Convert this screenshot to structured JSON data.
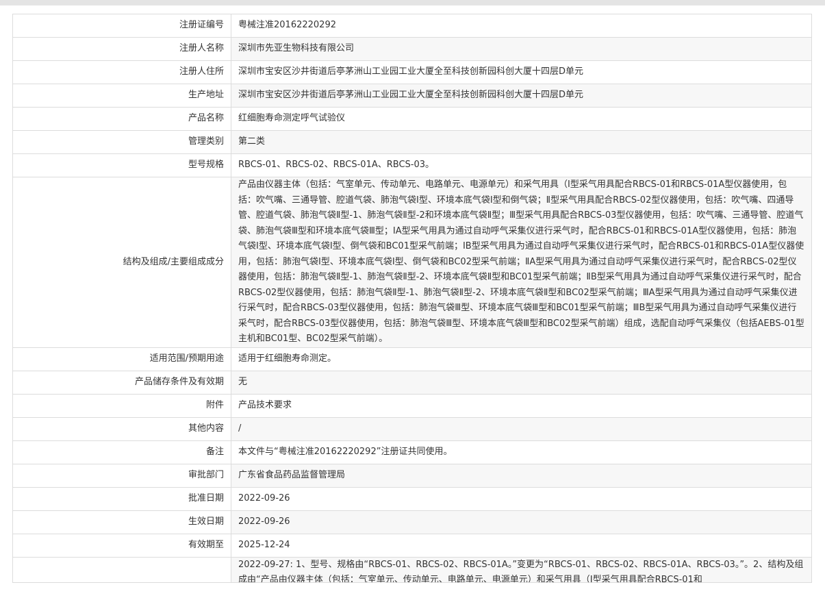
{
  "rows": [
    {
      "label": "注册证编号",
      "value": "粤械注准20162220292"
    },
    {
      "label": "注册人名称",
      "value": "深圳市先亚生物科技有限公司"
    },
    {
      "label": "注册人住所",
      "value": "深圳市宝安区沙井街道后亭茅洲山工业园工业大厦全至科技创新园科创大厦十四层D单元"
    },
    {
      "label": "生产地址",
      "value": "深圳市宝安区沙井街道后亭茅洲山工业园工业大厦全至科技创新园科创大厦十四层D单元"
    },
    {
      "label": "产品名称",
      "value": "红细胞寿命测定呼气试验仪"
    },
    {
      "label": "管理类别",
      "value": "第二类"
    },
    {
      "label": "型号规格",
      "value": "RBCS-01、RBCS-02、RBCS-01A、RBCS-03。"
    },
    {
      "label": "结构及组成/主要组成成分",
      "value": "产品由仪器主体（包括：气室单元、传动单元、电路单元、电源单元）和采气用具（Ⅰ型采气用具配合RBCS-01和RBCS-01A型仪器使用，包括：吹气嘴、三通导管、腔道气袋、肺泡气袋Ⅰ型、环境本底气袋Ⅰ型和倒气袋；Ⅱ型采气用具配合RBCS-02型仪器使用，包括：吹气嘴、四通导管、腔道气袋、肺泡气袋Ⅱ型-1、肺泡气袋Ⅱ型-2和环境本底气袋Ⅱ型；Ⅲ型采气用具配合RBCS-03型仪器使用，包括：吹气嘴、三通导管、腔道气袋、肺泡气袋Ⅲ型和环境本底气袋Ⅲ型；ⅠA型采气用具为通过自动呼气采集仪进行采气时，配合RBCS-01和RBCS-01A型仪器使用，包括：肺泡气袋Ⅰ型、环境本底气袋Ⅰ型、倒气袋和BC01型采气前端；ⅠB型采气用具为通过自动呼气采集仪进行采气时，配合RBCS-01和RBCS-01A型仪器使用，包括：肺泡气袋Ⅰ型、环境本底气袋Ⅰ型、倒气袋和BC02型采气前端；ⅡA型采气用具为通过自动呼气采集仪进行采气时，配合RBCS-02型仪器使用，包括：肺泡气袋Ⅱ型-1、肺泡气袋Ⅱ型-2、环境本底气袋Ⅱ型和BC01型采气前端；ⅡB型采气用具为通过自动呼气采集仪进行采气时，配合RBCS-02型仪器使用，包括：肺泡气袋Ⅱ型-1、肺泡气袋Ⅱ型-2、环境本底气袋Ⅱ型和BC02型采气前端；ⅢA型采气用具为通过自动呼气采集仪进行采气时，配合RBCS-03型仪器使用，包括：肺泡气袋Ⅲ型、环境本底气袋Ⅲ型和BC01型采气前端；ⅢB型采气用具为通过自动呼气采集仪进行采气时，配合RBCS-03型仪器使用，包括：肺泡气袋Ⅲ型、环境本底气袋Ⅲ型和BC02型采气前端）组成，选配自动呼气采集仪（包括AEBS-01型主机和BC01型、BC02型采气前端）。"
    },
    {
      "label": "适用范围/预期用途",
      "value": "适用于红细胞寿命测定。"
    },
    {
      "label": "产品储存条件及有效期",
      "value": "无"
    },
    {
      "label": "附件",
      "value": "产品技术要求"
    },
    {
      "label": "其他内容",
      "value": "/"
    },
    {
      "label": "备注",
      "value": "本文件与“粤械注准20162220292”注册证共同使用。"
    },
    {
      "label": "审批部门",
      "value": "广东省食品药品监督管理局"
    },
    {
      "label": "批准日期",
      "value": "2022-09-26"
    },
    {
      "label": "生效日期",
      "value": "2022-09-26"
    },
    {
      "label": "有效期至",
      "value": "2025-12-24"
    },
    {
      "label": "",
      "value": "2022-09-27: 1、型号、规格由“RBCS-01、RBCS-02、RBCS-01A。”变更为“RBCS-01、RBCS-02、RBCS-01A、RBCS-03。”。2、结构及组成由“产品由仪器主体（包括：气室单元、传动单元、电路单元、电源单元）和采气用具（Ⅰ型采气用具配合RBCS-01和"
    }
  ]
}
